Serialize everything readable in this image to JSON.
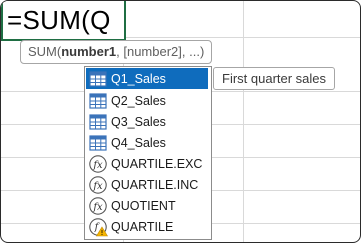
{
  "formula_bar": {
    "text": "=SUM(Q"
  },
  "tooltip": {
    "function": "SUM",
    "open_paren": "(",
    "current_arg": "number1",
    "rest": ", [number2], ...)"
  },
  "autocomplete": {
    "items": [
      {
        "label": "Q1_Sales",
        "icon": "table-icon",
        "selected": true
      },
      {
        "label": "Q2_Sales",
        "icon": "table-icon",
        "selected": false
      },
      {
        "label": "Q3_Sales",
        "icon": "table-icon",
        "selected": false
      },
      {
        "label": "Q4_Sales",
        "icon": "table-icon",
        "selected": false
      },
      {
        "label": "QUARTILE.EXC",
        "icon": "function-icon",
        "selected": false
      },
      {
        "label": "QUARTILE.INC",
        "icon": "function-icon",
        "selected": false
      },
      {
        "label": "QUOTIENT",
        "icon": "function-icon",
        "selected": false
      },
      {
        "label": "QUARTILE",
        "icon": "function-warning-icon",
        "selected": false
      }
    ]
  },
  "description": {
    "text": "First quarter sales"
  },
  "colors": {
    "selection": "#0f6cbd",
    "active_cell_border": "#1f6e43",
    "table_icon_blue": "#3b73b9",
    "warning": "#f5b400"
  }
}
